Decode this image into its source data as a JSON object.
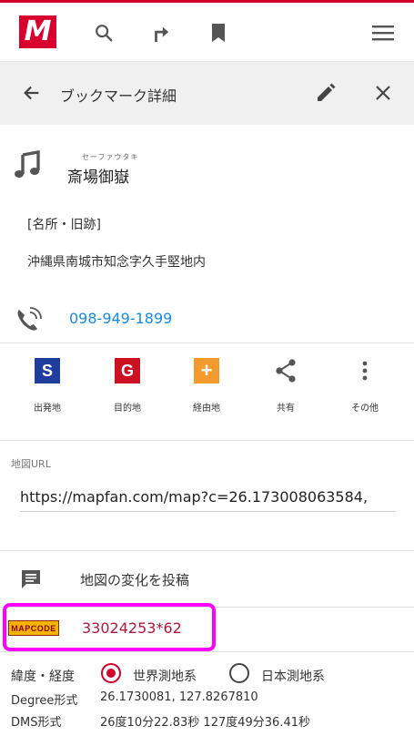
{
  "colors": {
    "brand": "#d8002e",
    "link": "#1a8ae0",
    "mapcode": "#b0173b",
    "highlight": "#ff00ff",
    "start": "#1f3d9c",
    "goal": "#cc1122",
    "via": "#f29a2e"
  },
  "header": {
    "logo_text": "M",
    "icons": [
      "search-icon",
      "route-icon",
      "bookmark-icon",
      "menu-icon"
    ]
  },
  "subbar": {
    "title": "ブックマーク詳細",
    "icons": [
      "back-arrow-icon",
      "edit-icon",
      "close-icon"
    ]
  },
  "place": {
    "ruby": "セーファウタキ",
    "name": "斎場御嶽",
    "category": "[名所・旧跡]",
    "address": "沖縄県南城市知念字久手堅地内",
    "phone": "098-949-1899"
  },
  "actions": [
    {
      "label": "出発地",
      "glyph": "S"
    },
    {
      "label": "目的地",
      "glyph": "G"
    },
    {
      "label": "経由地",
      "glyph": "+"
    },
    {
      "label": "共有",
      "glyph": ""
    },
    {
      "label": "その他",
      "glyph": ""
    }
  ],
  "map_url": {
    "label": "地図URL",
    "value": "https://mapfan.com/map?c=26.173008063584,"
  },
  "post": {
    "label": "地図の変化を投稿"
  },
  "mapcode": {
    "logo_text": "MAPCODE",
    "value": "33024253*62"
  },
  "coords": {
    "label": "緯度・経度",
    "options": [
      {
        "label": "世界測地系",
        "selected": true
      },
      {
        "label": "日本測地系",
        "selected": false
      }
    ],
    "degree_label": "Degree形式",
    "degree_value": "26.1730081, 127.8267810",
    "dms_label": "DMS形式",
    "dms_value": "26度10分22.83秒 127度49分36.41秒"
  }
}
